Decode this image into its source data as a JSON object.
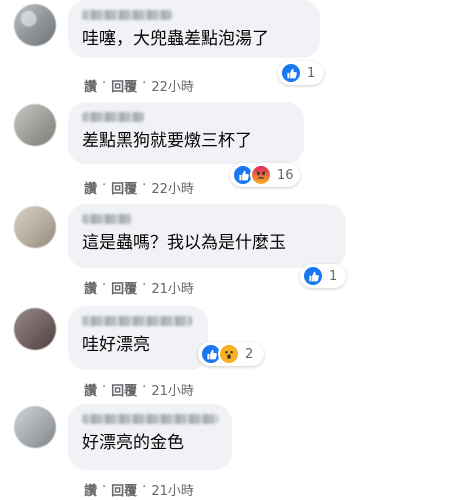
{
  "colors": {
    "like": "#1877f2",
    "emoji": "#f7b125",
    "angry": "#e0245e",
    "meta": "#65676b",
    "bubble": "#f0f2f5"
  },
  "comments": [
    {
      "text": "哇噻，大兜蟲差點泡湯了",
      "actions": {
        "like": "讚",
        "reply": "回覆",
        "time": "22小時"
      },
      "reactions": {
        "icons": [
          "like-icon"
        ],
        "count": "1"
      }
    },
    {
      "text": "差點黑狗就要燉三杯了",
      "actions": {
        "like": "讚",
        "reply": "回覆",
        "time": "22小時"
      },
      "reactions": {
        "icons": [
          "like-icon",
          "angry-icon"
        ],
        "count": "16"
      }
    },
    {
      "text": "這是蟲嗎？我以為是什麼玉",
      "actions": {
        "like": "讚",
        "reply": "回覆",
        "time": "21小時"
      },
      "reactions": {
        "icons": [
          "like-icon"
        ],
        "count": "1"
      }
    },
    {
      "text": "哇好漂亮",
      "actions": {
        "like": "讚",
        "reply": "回覆",
        "time": "21小時"
      },
      "reactions": {
        "icons": [
          "like-icon",
          "wow-icon"
        ],
        "count": "2"
      }
    },
    {
      "text": "好漂亮的金色",
      "actions": {
        "like": "讚",
        "reply": "回覆",
        "time": "21小時"
      },
      "reactions": {
        "icons": [],
        "count": ""
      }
    }
  ]
}
